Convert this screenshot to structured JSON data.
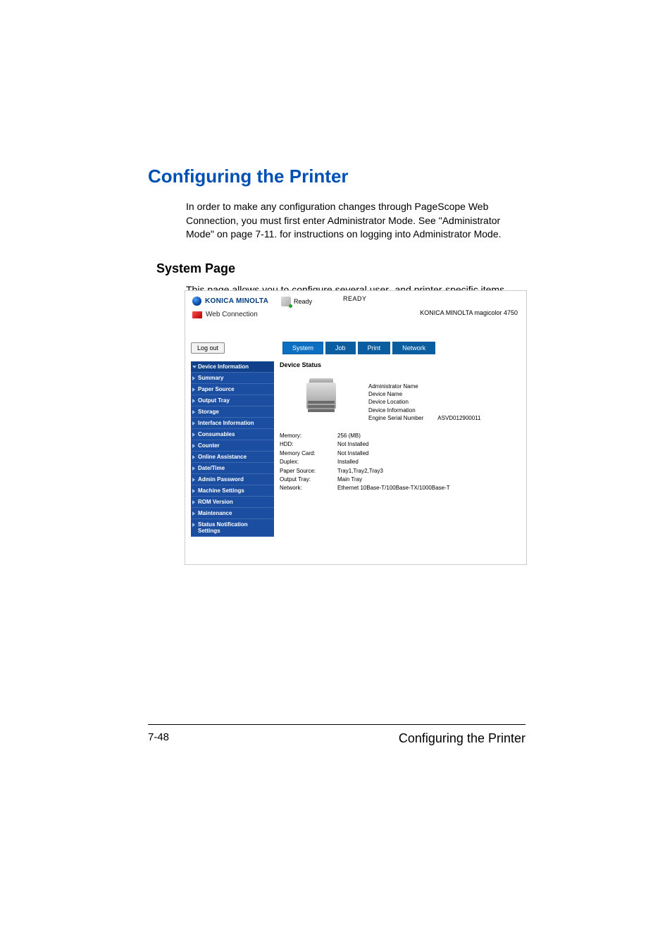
{
  "doc": {
    "h1": "Configuring the Printer",
    "para1": "In order to make any configuration changes through PageScope Web Connection, you must first enter Administrator Mode. See \"Administrator Mode\" on page 7-11. for instructions on logging into Administrator Mode.",
    "h2": "System Page",
    "para2": "This page allows you to configure several user- and printer-specific items."
  },
  "app": {
    "brand": "KONICA MINOLTA",
    "webconn": "Web Connection",
    "status_small": "Ready",
    "status_big": "READY",
    "model": "KONICA MINOLTA magicolor 4750",
    "logout": "Log out",
    "tabs": {
      "system": "System",
      "job": "Job",
      "print": "Print",
      "network": "Network"
    },
    "sidebar": [
      "Device Information",
      "Summary",
      "Paper Source",
      "Output Tray",
      "Storage",
      "Interface Information",
      "Consumables",
      "Counter",
      "Online Assistance",
      "Date/Time",
      "Admin Password",
      "Machine Settings",
      "ROM Version",
      "Maintenance",
      "Status Notification Settings"
    ],
    "main": {
      "section_title": "Device Status",
      "info_labels": {
        "admin_name": "Administrator Name",
        "device_name": "Device Name",
        "device_location": "Device Location",
        "device_info": "Device Information",
        "serial_label": "Engine Serial Number",
        "serial_value": "ASVD012900011"
      },
      "specs": [
        {
          "k": "Memory:",
          "v": "256 (MB)"
        },
        {
          "k": "HDD:",
          "v": "Not Installed"
        },
        {
          "k": "Memory Card:",
          "v": "Not Installed"
        },
        {
          "k": "Duplex:",
          "v": "Installed"
        },
        {
          "k": "Paper Source:",
          "v": "Tray1,Tray2,Tray3"
        },
        {
          "k": "Output Tray:",
          "v": "Main Tray"
        },
        {
          "k": "Network:",
          "v": "Ethernet 10Base-T/100Base-TX/1000Base-T"
        }
      ]
    }
  },
  "footer": {
    "page": "7-48",
    "title": "Configuring the Printer"
  }
}
